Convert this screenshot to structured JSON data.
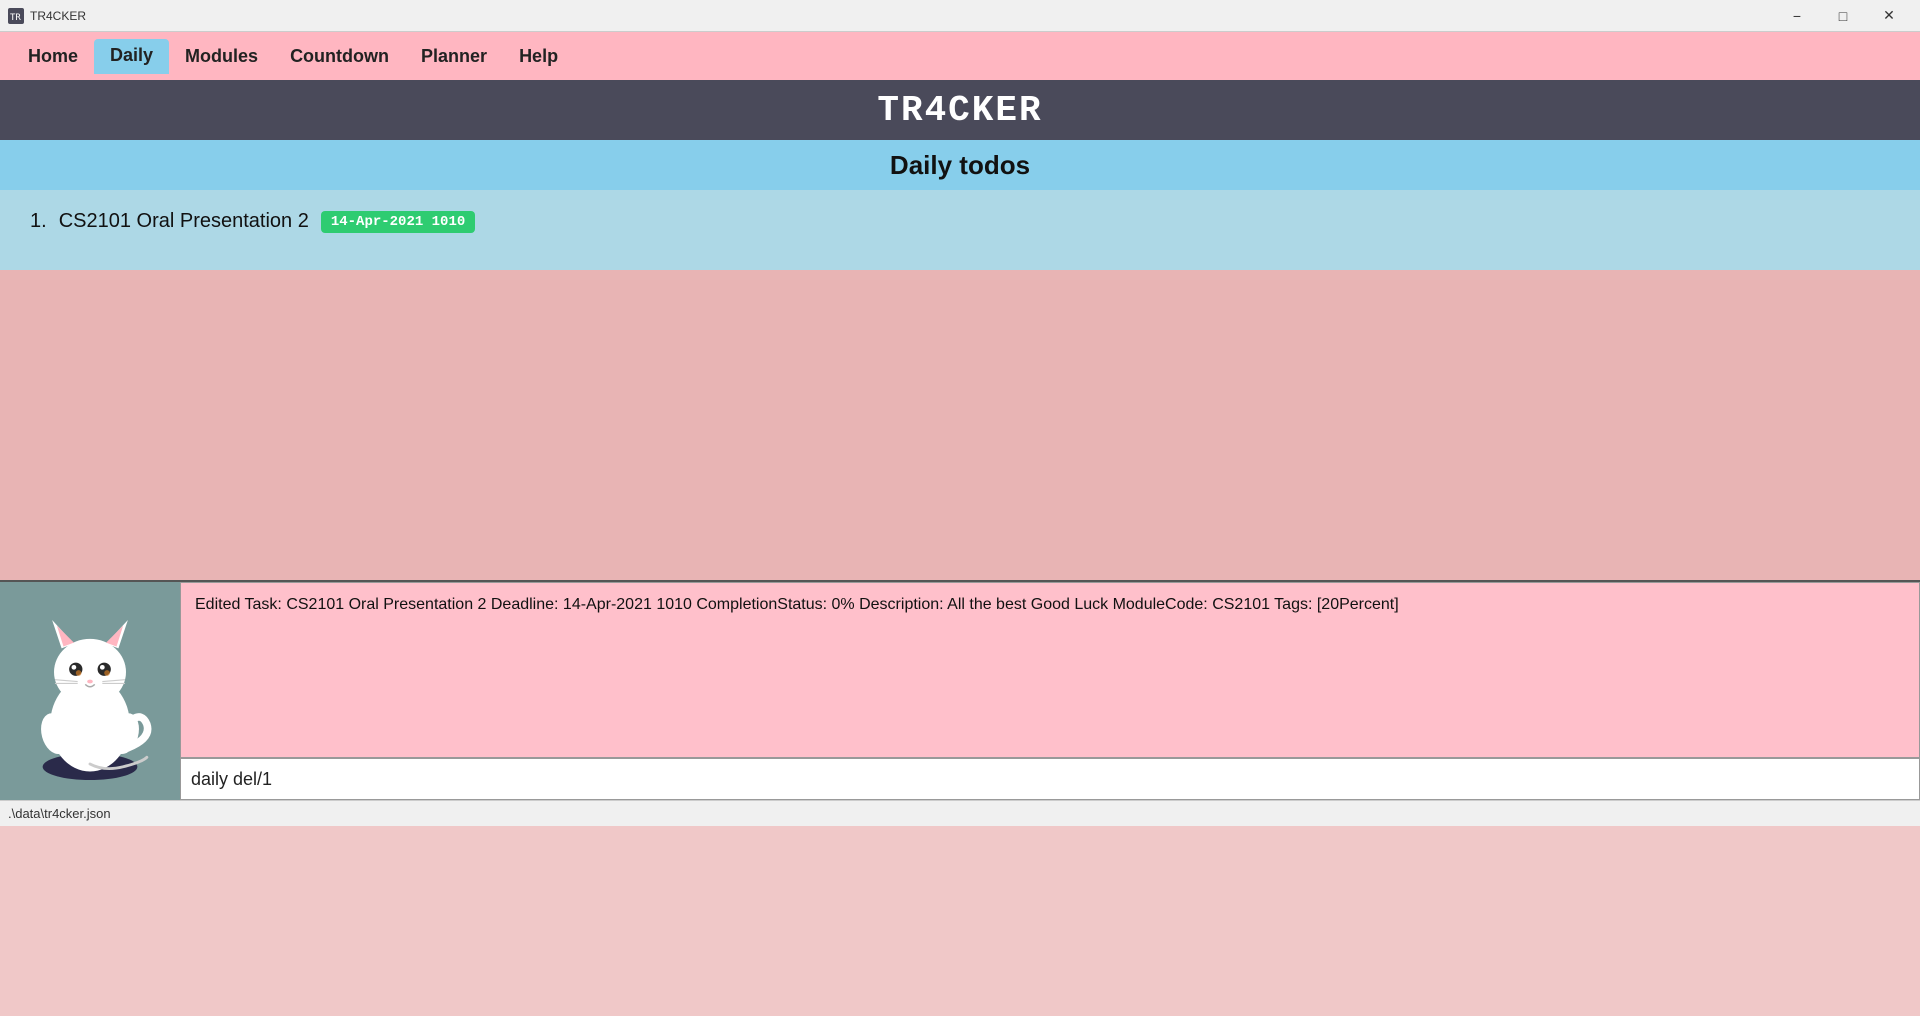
{
  "titleBar": {
    "appName": "TR4CKER",
    "minimizeLabel": "−",
    "maximizeLabel": "□",
    "closeLabel": "✕"
  },
  "nav": {
    "items": [
      {
        "id": "home",
        "label": "Home",
        "active": false
      },
      {
        "id": "daily",
        "label": "Daily",
        "active": true
      },
      {
        "id": "modules",
        "label": "Modules",
        "active": false
      },
      {
        "id": "countdown",
        "label": "Countdown",
        "active": false
      },
      {
        "id": "planner",
        "label": "Planner",
        "active": false
      },
      {
        "id": "help",
        "label": "Help",
        "active": false
      }
    ]
  },
  "header": {
    "appTitle": "TR4CKER",
    "sectionTitle": "Daily todos"
  },
  "todos": {
    "items": [
      {
        "number": "1.",
        "text": "CS2101 Oral Presentation 2",
        "badge": "14-Apr-2021 1010"
      }
    ]
  },
  "output": {
    "text": "Edited Task: CS2101 Oral Presentation 2 Deadline: 14-Apr-2021 1010 CompletionStatus: 0% Description: All the best Good Luck ModuleCode: CS2101 Tags: [20Percent]"
  },
  "commandInput": {
    "value": "daily del/1",
    "placeholder": ""
  },
  "statusBar": {
    "path": ".\\data\\tr4cker.json"
  },
  "colors": {
    "navBg": "#ffb6c1",
    "activeTab": "#87ceeb",
    "headerBg": "#4a4a5a",
    "sectionBg": "#87ceeb",
    "todoAreaBg": "#add8e6",
    "mainBg": "#e8b4b4",
    "bottomBg": "#7a9a9a",
    "outputBg": "#ffc0cb",
    "badgeBg": "#2ecc71"
  }
}
